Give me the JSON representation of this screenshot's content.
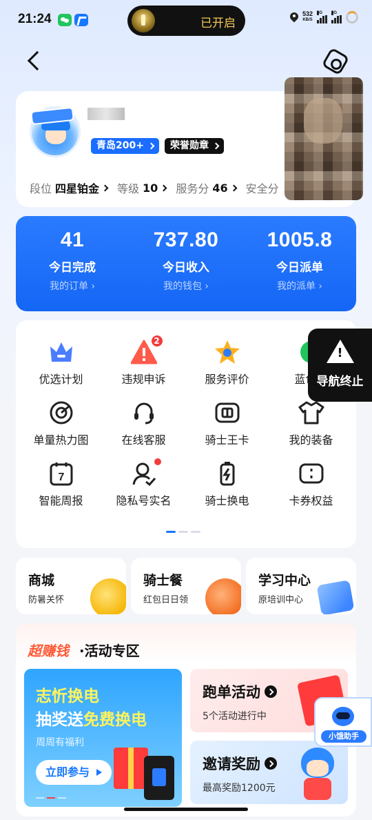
{
  "status_bar": {
    "time": "21:24",
    "island_text": "已开启",
    "net_speed": "532",
    "net_unit": "KB/S",
    "signal1": "5G",
    "signal2": "5G"
  },
  "profile": {
    "city_tag": "青岛200+",
    "medal_tag": "荣誉勋章",
    "stats": [
      {
        "label": "段位",
        "value": "四星铂金"
      },
      {
        "label": "等级",
        "value": "10"
      },
      {
        "label": "服务分",
        "value": "46"
      },
      {
        "label": "安全分",
        "value": ""
      }
    ]
  },
  "earnings": [
    {
      "value": "41",
      "label": "今日完成",
      "link": "我的订单 ›"
    },
    {
      "value": "737.80",
      "label": "今日收入",
      "link": "我的钱包 ›"
    },
    {
      "value": "1005.8",
      "label": "今日派单",
      "link": "我的派单 ›"
    }
  ],
  "menu": [
    {
      "label": "优选计划",
      "icon": "crown-icon"
    },
    {
      "label": "违规申诉",
      "icon": "warning-icon",
      "badge": "2"
    },
    {
      "label": "服务评价",
      "icon": "star-icon"
    },
    {
      "label": "蓝色风",
      "icon": "leaf-icon"
    },
    {
      "label": "单量热力图",
      "icon": "target-icon"
    },
    {
      "label": "在线客服",
      "icon": "headset-icon"
    },
    {
      "label": "骑士王卡",
      "icon": "card-icon"
    },
    {
      "label": "我的装备",
      "icon": "shirt-icon"
    },
    {
      "label": "智能周报",
      "icon": "calendar-icon",
      "calendar_day": "7"
    },
    {
      "label": "隐私号实名",
      "icon": "user-verify-icon"
    },
    {
      "label": "骑士换电",
      "icon": "battery-swap-icon"
    },
    {
      "label": "卡券权益",
      "icon": "coupon-icon"
    }
  ],
  "nav_end": {
    "label": "导航终止"
  },
  "mini_cards": [
    {
      "title": "商城",
      "sub": "防暑关怀"
    },
    {
      "title": "骑士餐",
      "sub": "红包日日领"
    },
    {
      "title": "学习中心",
      "sub": "原培训中心"
    }
  ],
  "activity": {
    "brand": "超赚钱",
    "title": "·活动专区",
    "promo": {
      "line1": "志忻换电",
      "line2_a": "抽奖送",
      "line2_b": "免费换电",
      "sub": "周周有福利",
      "button": "立即参与"
    },
    "tiles": [
      {
        "title": "跑单活动",
        "sub": "5个活动进行中"
      },
      {
        "title": "邀请奖励",
        "sub": "最高奖励1200元"
      }
    ]
  },
  "assistant": {
    "label": "小饿助手"
  }
}
